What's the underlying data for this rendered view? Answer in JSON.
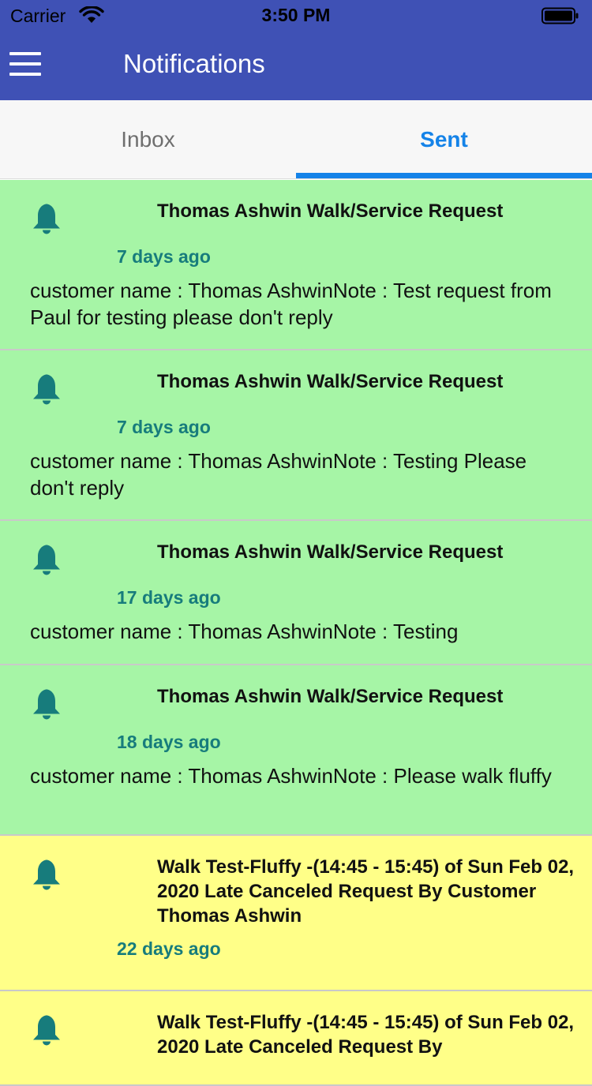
{
  "status_bar": {
    "carrier": "Carrier",
    "time": "3:50 PM"
  },
  "app_bar": {
    "title": "Notifications",
    "menu_icon": "hamburger-menu-icon"
  },
  "tabs": [
    {
      "label": "Inbox",
      "active": false
    },
    {
      "label": "Sent",
      "active": true
    }
  ],
  "colors": {
    "app_bar": "#3f51b5",
    "accent": "#1583e8",
    "item_green": "#a6f5a6",
    "item_yellow": "#ffff88",
    "time_text": "#177c7c",
    "bell": "#177c7c"
  },
  "notifications": [
    {
      "icon": "bell-icon",
      "title": "Thomas Ashwin Walk/Service Request",
      "time": "7 days ago",
      "body": "customer name : Thomas AshwinNote : Test request from Paul for testing please don't reply"
    },
    {
      "icon": "bell-icon",
      "title": "Thomas Ashwin Walk/Service Request",
      "time": "7 days ago",
      "body": "customer name : Thomas AshwinNote : Testing Please don't reply"
    },
    {
      "icon": "bell-icon",
      "title": "Thomas Ashwin Walk/Service Request",
      "time": "17 days ago",
      "body": "customer name : Thomas AshwinNote : Testing"
    },
    {
      "icon": "bell-icon",
      "title": "Thomas Ashwin Walk/Service Request",
      "time": "18 days ago",
      "body": "customer name : Thomas AshwinNote : Please walk fluffy"
    },
    {
      "icon": "bell-icon",
      "title": "Walk Test-Fluffy -(14:45 - 15:45) of Sun Feb 02, 2020 Late Canceled Request By Customer Thomas Ashwin",
      "time": "22 days ago",
      "body": ""
    },
    {
      "icon": "bell-icon",
      "title": "Walk Test-Fluffy -(14:45 - 15:45) of Sun Feb 02, 2020 Late Canceled Request By",
      "time": "",
      "body": ""
    }
  ]
}
